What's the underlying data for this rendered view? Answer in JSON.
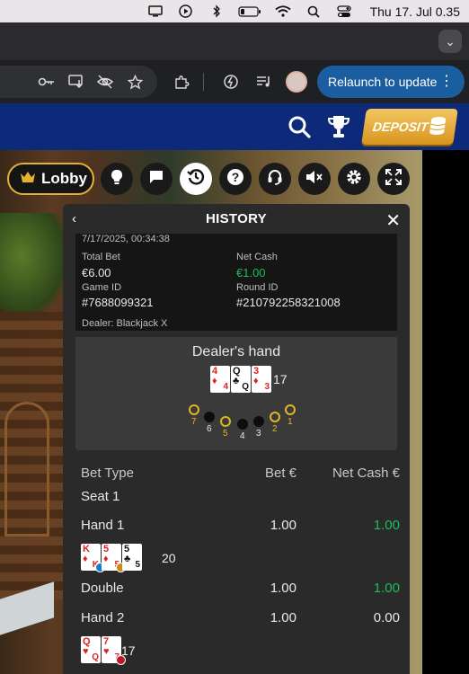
{
  "menubar": {
    "clock": "Thu 17. Jul  0.35"
  },
  "browser": {
    "relaunch_label": "Relaunch to update"
  },
  "site": {
    "deposit_label": "DEPOSIT"
  },
  "controls": {
    "lobby_label": "Lobby"
  },
  "history": {
    "title": "HISTORY",
    "datetime": "7/17/2025, 00:34:38",
    "total_bet_label": "Total Bet",
    "total_bet_value": "€6.00",
    "net_cash_label": "Net Cash",
    "net_cash_value": "€1.00",
    "game_id_label": "Game ID",
    "game_id_value": "#7688099321",
    "round_id_label": "Round ID",
    "round_id_value": "#210792258321008",
    "dealer_text": "Dealer: Blackjack X",
    "dealers_hand_title": "Dealer's hand",
    "dealer_cards": [
      {
        "rank": "4",
        "suit": "♦",
        "color": "red"
      },
      {
        "rank": "Q",
        "suit": "♣",
        "color": "black"
      },
      {
        "rank": "3",
        "suit": "♦",
        "color": "red"
      }
    ],
    "dealer_total": "17",
    "seats": [
      "7",
      "6",
      "5",
      "4",
      "3",
      "2",
      "1"
    ],
    "table_headers": {
      "type": "Bet Type",
      "bet": "Bet €",
      "net": "Net Cash €"
    },
    "seat_label": "Seat 1",
    "rows": [
      {
        "type": "Hand 1",
        "bet": "1.00",
        "net": "1.00"
      },
      {
        "type": "Double",
        "bet": "1.00",
        "net": "1.00"
      },
      {
        "type": "Hand 2",
        "bet": "1.00",
        "net": "0.00"
      }
    ],
    "hand1_cards": [
      {
        "rank": "K",
        "suit": "♦",
        "color": "red"
      },
      {
        "rank": "5",
        "suit": "♦",
        "color": "red"
      },
      {
        "rank": "5",
        "suit": "♣",
        "color": "black"
      }
    ],
    "hand1_total": "20",
    "hand2_cards": [
      {
        "rank": "Q",
        "suit": "♥",
        "color": "red"
      },
      {
        "rank": "7",
        "suit": "♥",
        "color": "red"
      }
    ],
    "hand2_total": "17"
  },
  "colors": {
    "accent_gold": "#e3b230",
    "win_green": "#1bbf5a",
    "site_blue": "#0d2a7a",
    "relaunch_blue": "#1b5ea0"
  }
}
